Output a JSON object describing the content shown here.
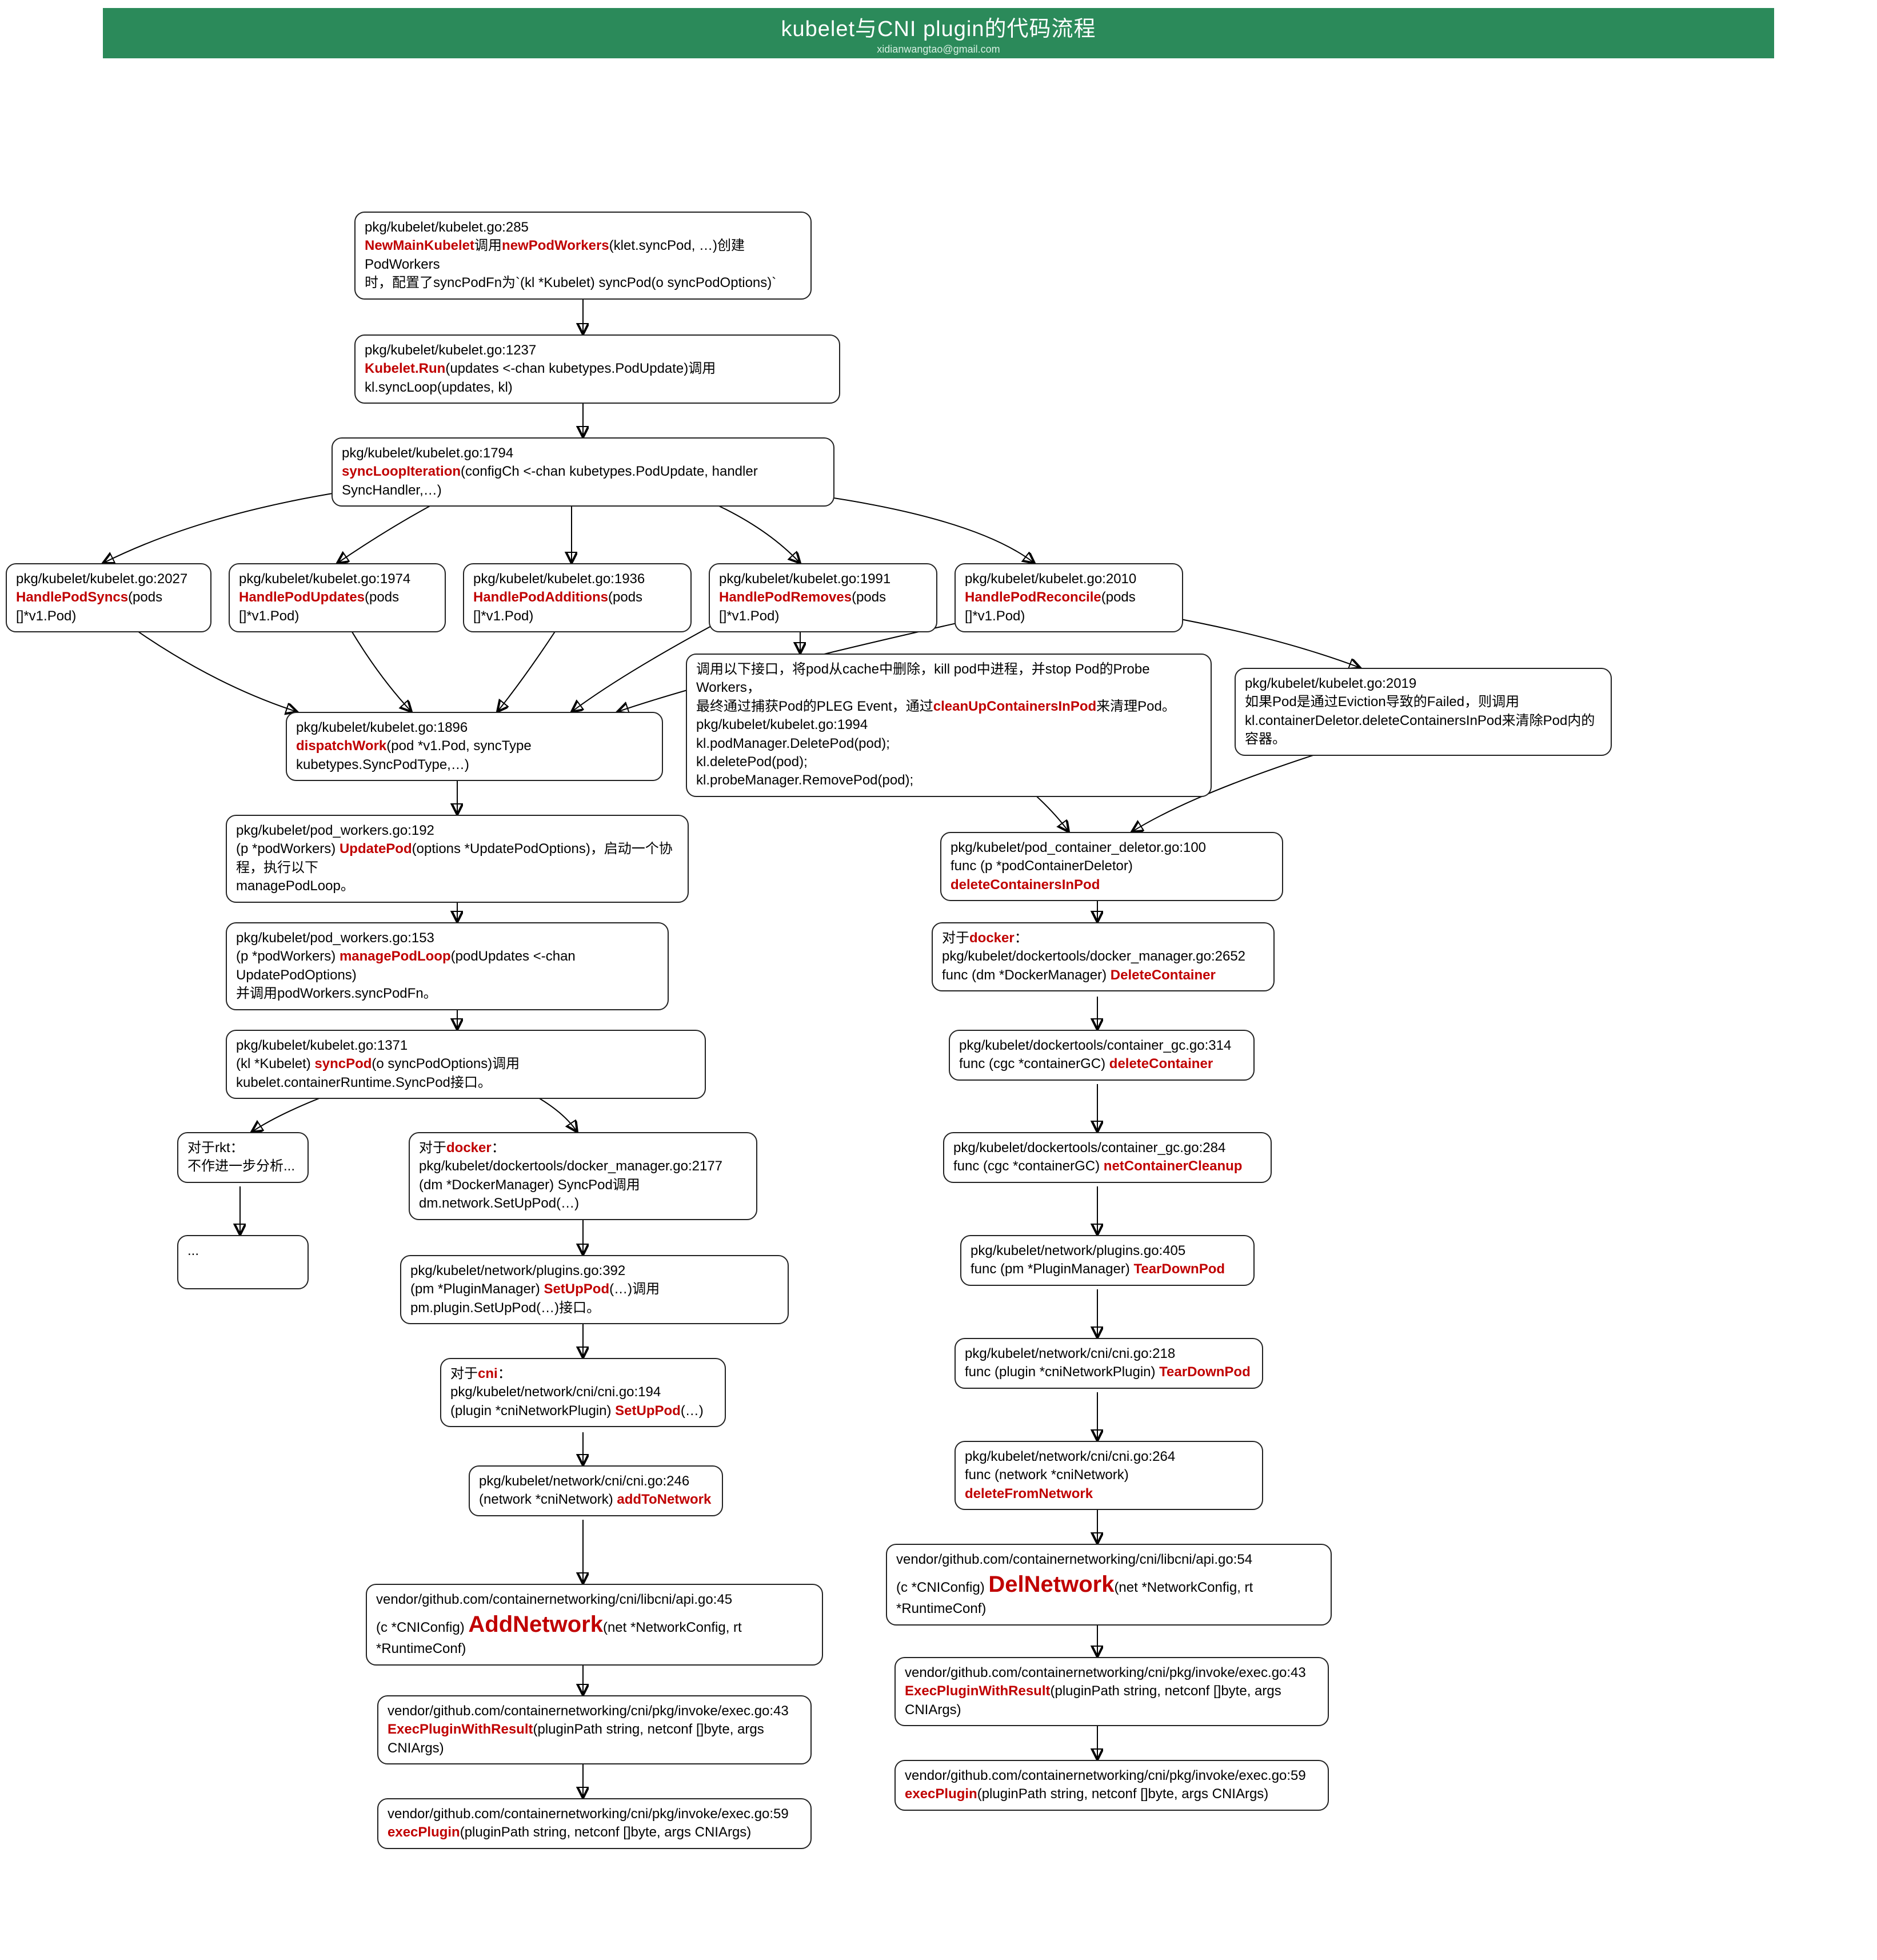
{
  "header": {
    "title": "kubelet与CNI plugin的代码流程",
    "subtitle": "xidianwangtao@gmail.com"
  },
  "nodes": {
    "n1": {
      "file": "pkg/kubelet/kubelet.go:285",
      "line2_a": "NewMainKubelet",
      "line2_b": "调用",
      "line2_c": "newPodWorkers",
      "line2_d": "(klet.syncPod, …)创建PodWorkers",
      "line3": "时，配置了syncPodFn为`(kl *Kubelet) syncPod(o syncPodOptions)`"
    },
    "n2": {
      "file": "pkg/kubelet/kubelet.go:1237",
      "fn": "Kubelet.Run",
      "rest": "(updates <-chan kubetypes.PodUpdate)调用kl.syncLoop(updates, kl)"
    },
    "n3": {
      "file": "pkg/kubelet/kubelet.go:1794",
      "fn": "syncLoopIteration",
      "rest": "(configCh <-chan kubetypes.PodUpdate, handler SyncHandler,…)"
    },
    "h_syncs": {
      "file": "pkg/kubelet/kubelet.go:2027",
      "fn": "HandlePodSyncs",
      "rest": "(pods []*v1.Pod)"
    },
    "h_updates": {
      "file": "pkg/kubelet/kubelet.go:1974",
      "fn": "HandlePodUpdates",
      "rest": "(pods []*v1.Pod)"
    },
    "h_additions": {
      "file": "pkg/kubelet/kubelet.go:1936",
      "fn": "HandlePodAdditions",
      "rest": "(pods []*v1.Pod)"
    },
    "h_removes": {
      "file": "pkg/kubelet/kubelet.go:1991",
      "fn": "HandlePodRemoves",
      "rest": "(pods []*v1.Pod)"
    },
    "h_reconcile": {
      "file": "pkg/kubelet/kubelet.go:2010",
      "fn": "HandlePodReconcile",
      "rest": "(pods []*v1.Pod)"
    },
    "dispatch": {
      "file": "pkg/kubelet/kubelet.go:1896",
      "fn": "dispatchWork",
      "rest": "(pod *v1.Pod, syncType kubetypes.SyncPodType,…)"
    },
    "removes_note": {
      "line1_a": "调用以下接口，将pod从cache中删除，kill pod中进程，并stop Pod的Probe Workers，",
      "line1_b": "最终通过捕获Pod的PLEG Event，通过",
      "line1_c": "cleanUpContainersInPod",
      "line1_d": "来清理Pod。",
      "line2": "pkg/kubelet/kubelet.go:1994",
      "line3": "kl.podManager.DeletePod(pod);",
      "line4": "kl.deletePod(pod);",
      "line5": "kl.probeManager.RemovePod(pod);"
    },
    "reconcile_note": {
      "line1": "pkg/kubelet/kubelet.go:2019",
      "line2": "如果Pod是通过Eviction导致的Failed，则调用",
      "line3": "kl.containerDeletor.deleteContainersInPod来清除Pod内的容器。"
    },
    "updatepod": {
      "file": "pkg/kubelet/pod_workers.go:192",
      "sig_a": "(p *podWorkers) ",
      "fn": "UpdatePod",
      "sig_b": "(options *UpdatePodOptions)，启动一个协程，执行以下",
      "line3": "managePodLoop。"
    },
    "managepodloop": {
      "file": "pkg/kubelet/pod_workers.go:153",
      "sig_a": "(p *podWorkers) ",
      "fn": "managePodLoop",
      "sig_b": "(podUpdates <-chan UpdatePodOptions)",
      "line3": "并调用podWorkers.syncPodFn。"
    },
    "syncpod": {
      "file": "pkg/kubelet/kubelet.go:1371",
      "sig_a": "(kl *Kubelet) ",
      "fn": "syncPod",
      "sig_b": "(o syncPodOptions)调用kubelet.containerRuntime.SyncPod接口。"
    },
    "rkt": {
      "line1": "对于rkt：",
      "line2": "不作进一步分析..."
    },
    "docker_syncpod": {
      "line1_a": "对于",
      "line1_b": "docker",
      "line1_c": "：",
      "line2": "pkg/kubelet/dockertools/docker_manager.go:2177",
      "line3": "(dm *DockerManager) SyncPod调用dm.network.SetUpPod(…)"
    },
    "ellipsis": {
      "text": "..."
    },
    "setuppod": {
      "file": "pkg/kubelet/network/plugins.go:392",
      "sig_a": "(pm *PluginManager) ",
      "fn": "SetUpPod",
      "sig_b": "(…)调用pm.plugin.SetUpPod(…)接口。"
    },
    "cni_setuppod": {
      "line1_a": "对于",
      "line1_b": "cni",
      "line1_c": "：",
      "line2": "pkg/kubelet/network/cni/cni.go:194",
      "sig_a": "(plugin *cniNetworkPlugin) ",
      "fn": "SetUpPod",
      "sig_b": "(…)"
    },
    "addtonet": {
      "file": "pkg/kubelet/network/cni/cni.go:246",
      "sig_a": "(network *cniNetwork) ",
      "fn": "addToNetwork"
    },
    "addnetwork": {
      "file": "vendor/github.com/containernetworking/cni/libcni/api.go:45",
      "sig_a": "(c *CNIConfig) ",
      "fn": "AddNetwork",
      "sig_b": "(net *NetworkConfig, rt *RuntimeConf)"
    },
    "exec1": {
      "file": "vendor/github.com/containernetworking/cni/pkg/invoke/exec.go:43",
      "fn": "ExecPluginWithResult",
      "sig_b": "(pluginPath string, netconf []byte, args CNIArgs)"
    },
    "exec2": {
      "file": "vendor/github.com/containernetworking/cni/pkg/invoke/exec.go:59",
      "fn": "execPlugin",
      "sig_b": "(pluginPath string, netconf []byte, args CNIArgs)"
    },
    "deletor": {
      "file": "pkg/kubelet/pod_container_deletor.go:100",
      "sig_a": "func (p *podContainerDeletor) ",
      "fn": "deleteContainersInPod"
    },
    "deletecontainer": {
      "line1_a": "对于",
      "line1_b": "docker",
      "line1_c": "：",
      "line2": "pkg/kubelet/dockertools/docker_manager.go:2652",
      "sig_a": "func (dm *DockerManager) ",
      "fn": "DeleteContainer"
    },
    "gc_deletecontainer": {
      "file": "pkg/kubelet/dockertools/container_gc.go:314",
      "sig_a": "func (cgc *containerGC) ",
      "fn": "deleteContainer"
    },
    "netcleanup": {
      "file": "pkg/kubelet/dockertools/container_gc.go:284",
      "sig_a": "func (cgc *containerGC) ",
      "fn": "netContainerCleanup"
    },
    "teardownpod": {
      "file": "pkg/kubelet/network/plugins.go:405",
      "sig_a": "func (pm *PluginManager) ",
      "fn": "TearDownPod"
    },
    "cni_teardownpod": {
      "file": "pkg/kubelet/network/cni/cni.go:218",
      "sig_a": "func (plugin *cniNetworkPlugin) ",
      "fn": "TearDownPod"
    },
    "deletefromnet": {
      "file": "pkg/kubelet/network/cni/cni.go:264",
      "sig_a": "func (network *cniNetwork) ",
      "fn": "deleteFromNetwork"
    },
    "delnetwork": {
      "file": "vendor/github.com/containernetworking/cni/libcni/api.go:54",
      "sig_a": "(c *CNIConfig) ",
      "fn": "DelNetwork",
      "sig_b": "(net *NetworkConfig, rt *RuntimeConf)"
    },
    "exec3": {
      "file": "vendor/github.com/containernetworking/cni/pkg/invoke/exec.go:43",
      "fn": "ExecPluginWithResult",
      "sig_b": "(pluginPath string, netconf []byte, args CNIArgs)"
    },
    "exec4": {
      "file": "vendor/github.com/containernetworking/cni/pkg/invoke/exec.go:59",
      "fn": "execPlugin",
      "sig_b": "(pluginPath string, netconf []byte, args CNIArgs)"
    }
  }
}
